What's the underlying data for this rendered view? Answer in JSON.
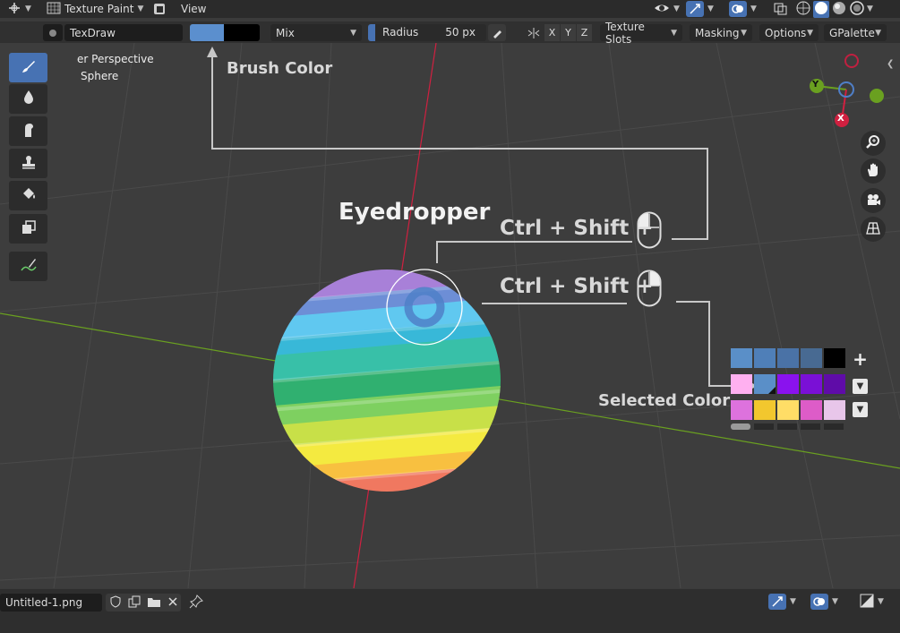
{
  "header": {
    "mode_label": "Texture Paint",
    "menu_view": "View"
  },
  "tool_settings": {
    "brush_name": "TexDraw",
    "brush_color": "#5b8fce",
    "secondary_color": "#000000",
    "blend_mode": "Mix",
    "radius_label": "Radius",
    "radius_value": "50 px",
    "axes": [
      "X",
      "Y",
      "Z"
    ],
    "texture_slots": "Texture Slots",
    "masking": "Masking",
    "options": "Options",
    "palette": "GPalette"
  },
  "viewport": {
    "perspective_label": "er Perspective",
    "object_label": "Sphere",
    "gizmo_axes": {
      "x": "X",
      "y": "Y"
    }
  },
  "annotations": {
    "brush_color": "Brush Color",
    "eyedropper": "Eyedropper",
    "shortcut_1": "Ctrl + Shift +",
    "shortcut_2": "Ctrl + Shift +",
    "selected_color": "Selected Color"
  },
  "palette": {
    "rows": [
      [
        "#5a8fc8",
        "#4f7fb8",
        "#4a72a6",
        "#486a92",
        "#000000"
      ],
      [
        "#ffb0f0",
        "#5a8fc8",
        "#8a12ee",
        "#7a10d6",
        "#5f0ca8"
      ],
      [
        "#dd72dd",
        "#f2c72e",
        "#ffdd66",
        "#dd5cc8",
        "#e8c6ea"
      ]
    ],
    "selected": {
      "row": 1,
      "col": 1
    }
  },
  "bottom": {
    "image_name": "Untitled-1.png"
  },
  "colors": {
    "accent": "#4772b3",
    "viewport_bg": "#3d3d3d",
    "axis_red": "#d02040",
    "axis_green": "#6aa020"
  }
}
